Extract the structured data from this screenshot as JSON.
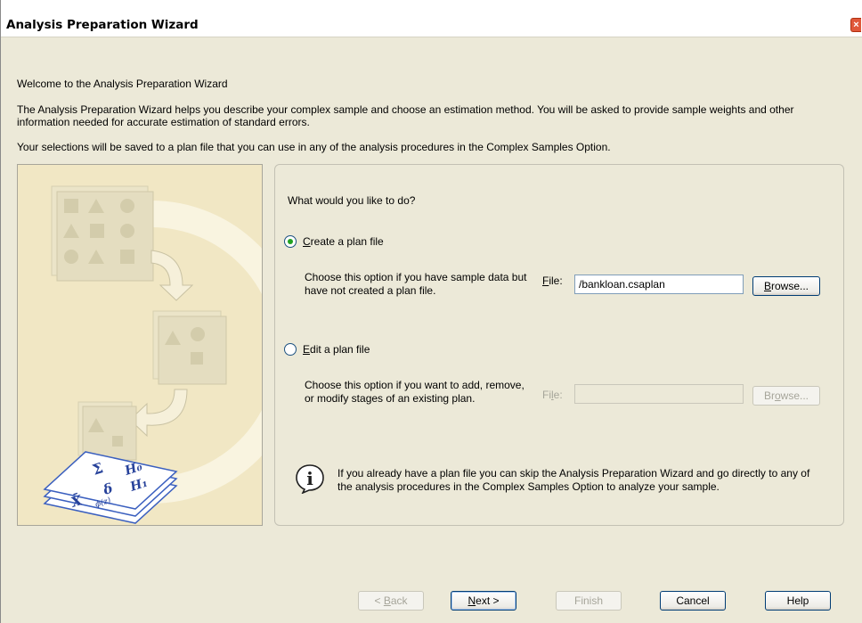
{
  "window": {
    "title": "Analysis Preparation Wizard",
    "close_label": "×"
  },
  "intro": {
    "welcome": "Welcome to the Analysis Preparation Wizard",
    "description": "The Analysis Preparation Wizard helps you describe your complex sample and choose an estimation method. You will be asked to provide sample weights and other information needed for accurate estimation of standard errors.",
    "save_note": "Your selections will be saved to a plan file that you can use in any of the analysis procedures in the Complex Samples Option."
  },
  "options": {
    "question": "What would you like to do?",
    "create": {
      "label_first": "C",
      "label_rest": "reate a plan file",
      "selected": true,
      "help": "Choose this option if you have sample data but have not created a plan file.",
      "file_label_first": "F",
      "file_label_rest": "ile:",
      "file_value": "/bankloan.csaplan",
      "browse_first": "B",
      "browse_rest": "rowse..."
    },
    "edit": {
      "label_first": "E",
      "label_rest": "dit a plan file",
      "selected": false,
      "help": "Choose this option if you want to add, remove, or modify stages of an existing plan.",
      "file_label_a": "Fi",
      "file_label_u": "l",
      "file_label_b": "e:",
      "file_value": "",
      "browse_a": "Br",
      "browse_u": "o",
      "browse_b": "wse..."
    },
    "info": "If you already have a plan file you can skip the Analysis Preparation Wizard and go directly to any of the analysis procedures in the Complex Samples Option to analyze your sample."
  },
  "footer": {
    "back_prefix": "< ",
    "back_u": "B",
    "back_rest": "ack",
    "next_u": "N",
    "next_rest": "ext >",
    "finish": "Finish",
    "cancel": "Cancel",
    "help": "Help"
  },
  "colors": {
    "dialog_bg": "#ece9d8",
    "art_bg": "#f1e7c4",
    "radio_dot": "#21a121",
    "button_border": "#003c74"
  }
}
